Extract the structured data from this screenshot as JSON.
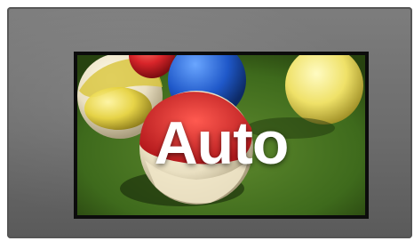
{
  "display": {
    "mode_label": "Auto",
    "bezel_color": "#6f6f6f",
    "screen_border_color": "#0c0c0c",
    "content_image": "billiard-balls-on-green-felt",
    "balls": [
      "yellow-white",
      "red",
      "blue",
      "yellow",
      "red-white"
    ]
  }
}
